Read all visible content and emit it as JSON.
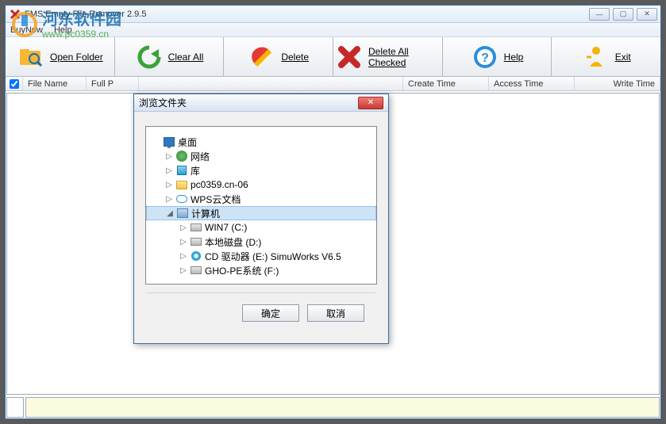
{
  "window": {
    "title": "FMS Empty File Remover 2.9.5",
    "controls": {
      "min": "—",
      "max": "▢",
      "close": "✕"
    }
  },
  "menu": {
    "items": [
      "BuyNow",
      "Help"
    ]
  },
  "toolbar": {
    "open": {
      "label": "Open Folder"
    },
    "clear": {
      "label": "Clear All"
    },
    "delete": {
      "label": "Delete"
    },
    "delall": {
      "label": "Delete All Checked"
    },
    "help": {
      "label": "Help"
    },
    "exit": {
      "label": "Exit"
    }
  },
  "columns": {
    "filename": "File Name",
    "fullpath": "Full P",
    "createtime": "Create Time",
    "accesstime": "Access Time",
    "writetime": "Write Time"
  },
  "dialog": {
    "title": "浏览文件夹",
    "ok": "确定",
    "cancel": "取消",
    "tree": {
      "desktop": "桌面",
      "network": "网络",
      "library": "库",
      "pcname": "pc0359.cn-06",
      "wps": "WPS云文档",
      "computer": "计算机",
      "drive_c": "WIN7 (C:)",
      "drive_d": "本地磁盘 (D:)",
      "drive_e": "CD 驱动器 (E:) SimuWorks V6.5",
      "drive_f": "GHO-PE系统 (F:)"
    }
  },
  "watermark": {
    "line1": "河东软件园",
    "line2": "www.pc0359.cn"
  }
}
